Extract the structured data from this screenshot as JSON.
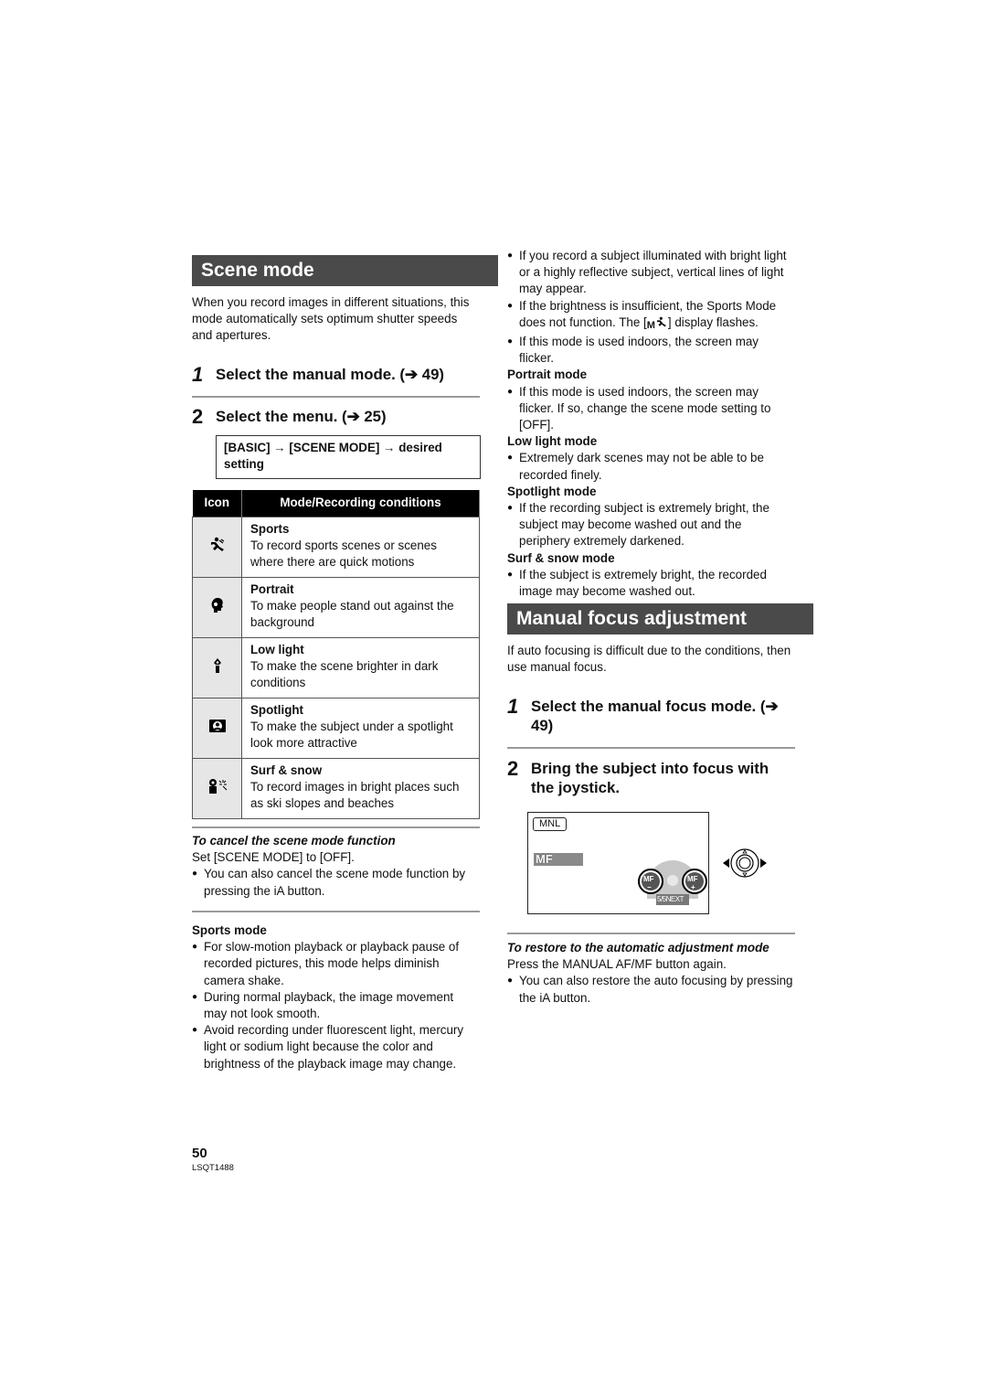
{
  "scene_mode": {
    "title": "Scene mode",
    "intro": "When you record images in different situations, this mode automatically sets optimum shutter speeds and apertures.",
    "step1": {
      "num": "1",
      "text": "Select the manual mode. (➔ 49)"
    },
    "step2": {
      "num": "2",
      "text": "Select the menu. (➔ 25)"
    },
    "menu_path_line1": "[BASIC] → [SCENE MODE] → desired",
    "menu_path_line2": "setting",
    "table": {
      "headers": [
        "Icon",
        "Mode/Recording conditions"
      ],
      "rows": [
        {
          "icon": "sports-icon",
          "mode": "Sports",
          "desc": "To record sports scenes or scenes where there are quick motions"
        },
        {
          "icon": "portrait-icon",
          "mode": "Portrait",
          "desc": "To make people stand out against the background"
        },
        {
          "icon": "low-light-icon",
          "mode": "Low light",
          "desc": "To make the scene brighter in dark conditions"
        },
        {
          "icon": "spotlight-icon",
          "mode": "Spotlight",
          "desc": "To make the subject under a spotlight look more attractive"
        },
        {
          "icon": "surf-snow-icon",
          "mode": "Surf & snow",
          "desc": "To record images in bright places such as ski slopes and beaches"
        }
      ]
    },
    "cancel": {
      "heading": "To cancel the scene mode function",
      "text": "Set [SCENE MODE] to [OFF].",
      "bullet": "You can also cancel the scene mode function by pressing the iA button."
    },
    "sports_mode": {
      "heading": "Sports mode",
      "bullets": [
        "For slow-motion playback or playback pause of recorded pictures, this mode helps diminish camera shake.",
        "During normal playback, the image movement may not look smooth.",
        "Avoid recording under fluorescent light, mercury light or sodium light because the color and brightness of the playback image may change."
      ]
    }
  },
  "right_notes": {
    "sports_bullets": [
      "If you record a subject illuminated with bright light or a highly reflective subject, vertical lines of light may appear.",
      {
        "before": "If the brightness is insufficient, the Sports Mode does not function. The [",
        "icon_label": "M",
        "after": "] display flashes."
      },
      "If this mode is used indoors, the screen may flicker."
    ],
    "portrait": {
      "heading": "Portrait mode",
      "bullet": "If this mode is used indoors, the screen may flicker. If so, change the scene mode setting to [OFF]."
    },
    "low_light": {
      "heading": "Low light mode",
      "bullet": "Extremely dark scenes may not be able to be recorded finely."
    },
    "spotlight": {
      "heading": "Spotlight mode",
      "bullet": "If the recording subject is extremely bright, the subject may become washed out and the periphery extremely darkened."
    },
    "surf_snow": {
      "heading": "Surf & snow mode",
      "bullet": "If the subject is extremely bright, the recorded image may become washed out."
    }
  },
  "manual_focus": {
    "title": "Manual focus adjustment",
    "intro": "If auto focusing is difficult due to the conditions, then use manual focus.",
    "step1": {
      "num": "1",
      "text": "Select the manual focus mode. (➔ 49)"
    },
    "step2": {
      "num": "2",
      "text": "Bring the subject into focus with the joystick."
    },
    "screen": {
      "mode_label": "MNL",
      "mf_label": "MF",
      "mf_minus": "MF",
      "mf_plus": "MF",
      "minus_sign": "−",
      "plus_sign": "+",
      "next_label": "5/5NEXT"
    },
    "restore": {
      "heading": "To restore to the automatic adjustment mode",
      "text": "Press the MANUAL AF/MF button again.",
      "bullet": "You can also restore the auto focusing by pressing the iA button."
    }
  },
  "footer": {
    "page_number": "50",
    "model": "LSQT1488"
  },
  "bullet_char": "●"
}
